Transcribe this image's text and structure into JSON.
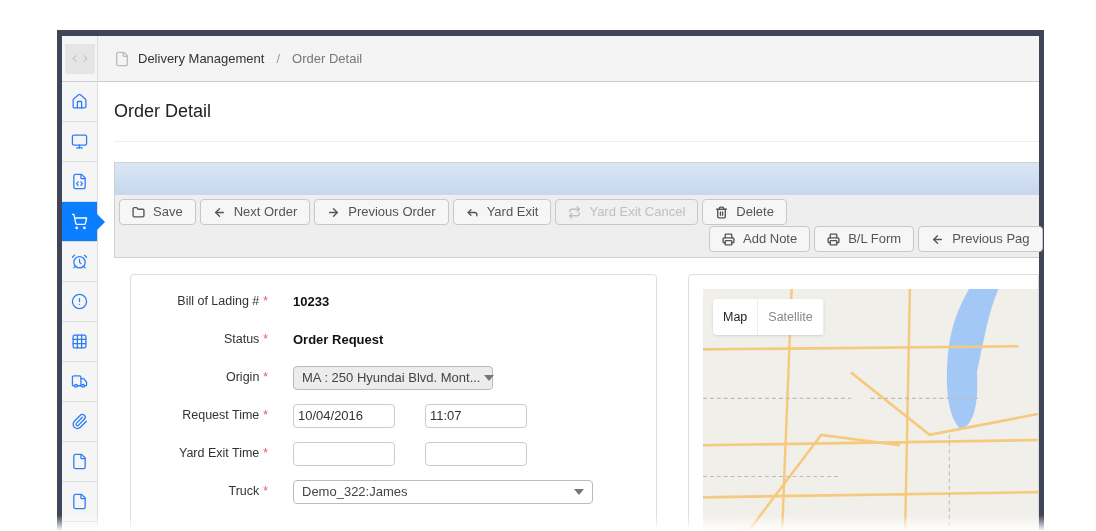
{
  "sidebar": {
    "items": [
      {
        "selected": false
      },
      {
        "selected": false
      },
      {
        "selected": false
      },
      {
        "selected": true
      },
      {
        "selected": false
      },
      {
        "selected": false
      },
      {
        "selected": false
      },
      {
        "selected": false
      },
      {
        "selected": false
      },
      {
        "selected": false
      },
      {
        "selected": false
      }
    ]
  },
  "breadcrumb": {
    "items": [
      "Delivery Management",
      "Order Detail"
    ],
    "separator": "/"
  },
  "page_title": "Order Detail",
  "toolbar": {
    "row_1": [
      {
        "label": "Save",
        "disabled": false
      },
      {
        "label": "Next Order",
        "disabled": false
      },
      {
        "label": "Previous Order",
        "disabled": false
      },
      {
        "label": "Yard Exit",
        "disabled": false
      },
      {
        "label": "Yard Exit Cancel",
        "disabled": true
      },
      {
        "label": "Delete",
        "disabled": false
      }
    ],
    "row_2": [
      {
        "label": "Add Note",
        "disabled": false
      },
      {
        "label": "B/L Form",
        "disabled": false
      },
      {
        "label": "Previous Pag",
        "disabled": false
      }
    ]
  },
  "form": {
    "fields": [
      {
        "kind": "static",
        "label": "Bill of Lading #",
        "required_mark": "*",
        "value": "10233"
      },
      {
        "kind": "static",
        "label": "Status",
        "required_mark": "*",
        "value": "Order Request"
      },
      {
        "kind": "select",
        "label": "Origin",
        "required_mark": "*",
        "value": "MA : 250 Hyundai Blvd. Mont...",
        "disabled": true
      },
      {
        "kind": "datetime",
        "label": "Request Time",
        "required_mark": "*",
        "date": "10/04/2016",
        "time": "11:07"
      },
      {
        "kind": "datetime",
        "label": "Yard Exit Time",
        "required_mark": "*"
      },
      {
        "kind": "select",
        "label": "Truck",
        "required_mark": "*",
        "value": "Demo_322:James",
        "disabled": false
      }
    ]
  },
  "map": {
    "types": [
      {
        "label": "Map",
        "selected": true
      },
      {
        "label": "Satellite",
        "selected": false
      }
    ]
  }
}
